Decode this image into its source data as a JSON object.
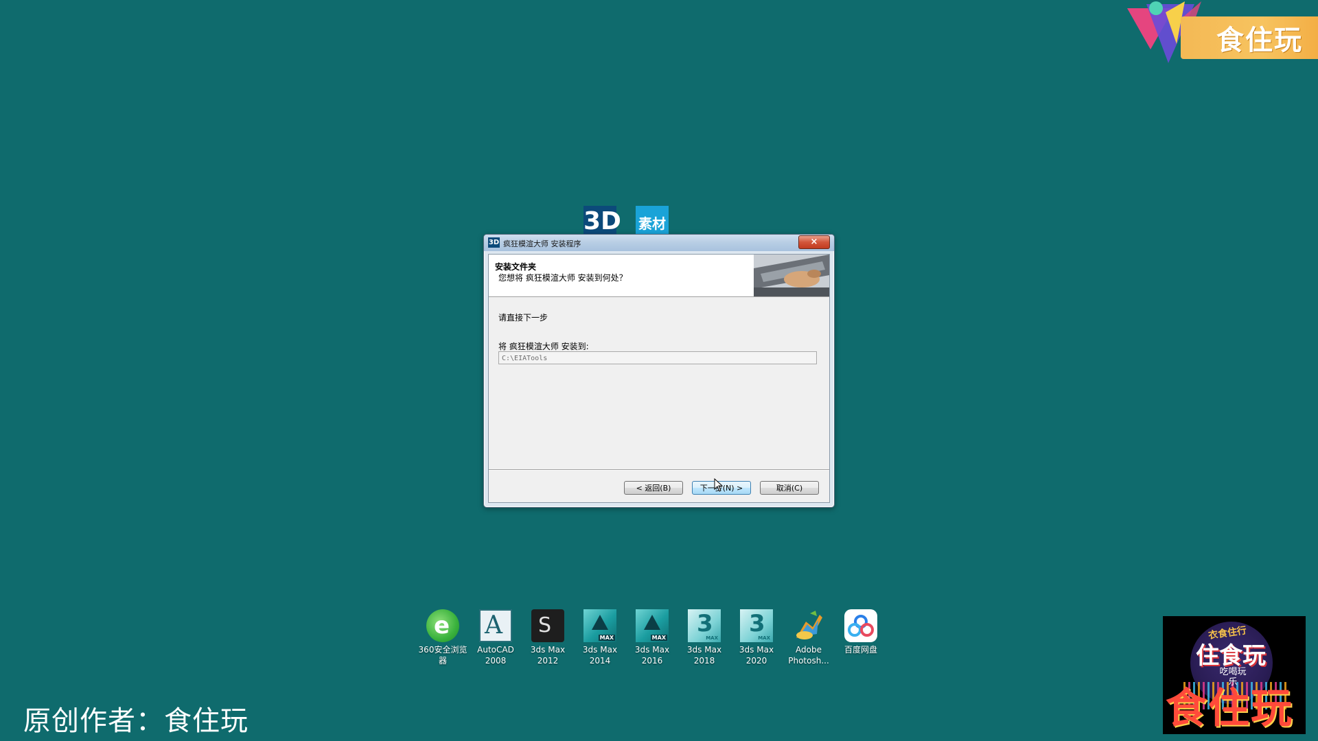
{
  "brand_banner": {
    "text": "食住玩",
    "colors": {
      "bar": "#f7c35f",
      "triangle_pink": "#e5457f",
      "triangle_purple": "#6a4bd8",
      "triangle_yellow": "#f7d04a",
      "dot_teal": "#4fd3b4"
    }
  },
  "center_logo": {
    "block1": "3D",
    "block2": "素材"
  },
  "dialog": {
    "icon_text": "3D",
    "title": "疯狂模渲大师 安装程序",
    "close_label": "×",
    "header_title": "安装文件夹",
    "header_subtitle": "您想将 疯狂模渲大师 安装到何处？",
    "body_text": "请直接下一步",
    "install_label": "将 疯狂模渲大师 安装到:",
    "path_value": "C:\\EIATools",
    "buttons": {
      "back": "< 返回(B)",
      "next": "下一步(N) >",
      "cancel": "取消(C)"
    }
  },
  "desktop_icons": [
    {
      "label": "360安全浏览器",
      "icon": "ie-360-icon",
      "glyph": "e"
    },
    {
      "label": "AutoCAD 2008",
      "icon": "autocad-icon",
      "glyph": "A"
    },
    {
      "label": "3ds Max 2012",
      "icon": "3dsmax-2012-icon",
      "glyph": "S"
    },
    {
      "label": "3ds Max 2014",
      "icon": "3dsmax-2014-icon",
      "glyph": "MAX"
    },
    {
      "label": "3ds Max 2016",
      "icon": "3dsmax-2016-icon",
      "glyph": "MAX"
    },
    {
      "label": "3ds Max 2018",
      "icon": "3dsmax-2018-icon",
      "glyph": "3"
    },
    {
      "label": "3ds Max 2020",
      "icon": "3dsmax-2020-icon",
      "glyph": "3"
    },
    {
      "label": "Adobe Photosh...",
      "icon": "photoshop-icon",
      "glyph": ""
    },
    {
      "label": "百度网盘",
      "icon": "baidu-netdisk-icon",
      "glyph": ""
    }
  ],
  "credit": "原创作者：食住玩",
  "logo_box": {
    "arc": "衣食住行",
    "mid": "住食玩",
    "small": "吃喝玩乐",
    "big": "食住玩"
  }
}
